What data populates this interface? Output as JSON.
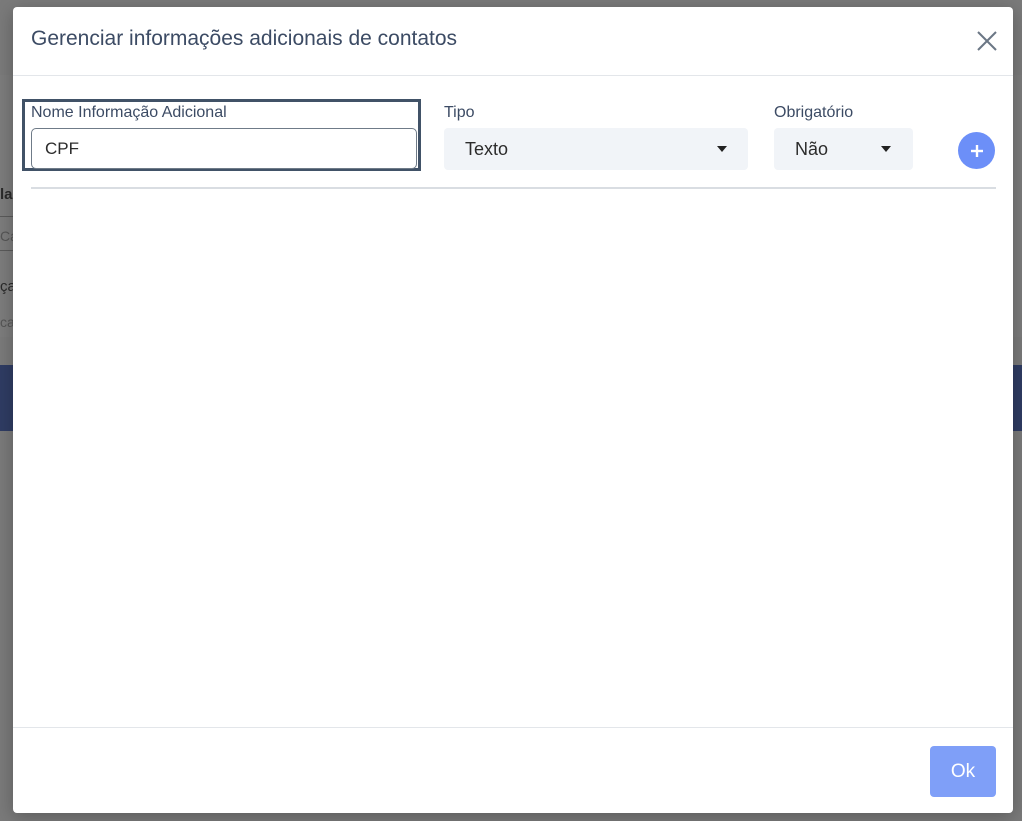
{
  "background": {
    "fragments": [
      "la",
      "Ca",
      "ça",
      "ca"
    ]
  },
  "modal": {
    "title": "Gerenciar informações adicionais de contatos",
    "close_icon": "close-icon",
    "fields": {
      "name": {
        "label": "Nome Informação Adicional",
        "value": "CPF",
        "placeholder": ""
      },
      "type": {
        "label": "Tipo",
        "selected": "Texto"
      },
      "required": {
        "label": "Obrigatório",
        "selected": "Não"
      }
    },
    "add_icon": "plus-icon",
    "footer": {
      "ok_label": "Ok"
    }
  },
  "colors": {
    "title": "#3c4b64",
    "accent_button": "#6c8ff8",
    "ok_button": "#7f9ff8",
    "select_bg": "#f1f4f8",
    "background_band": "#2f3c63"
  }
}
